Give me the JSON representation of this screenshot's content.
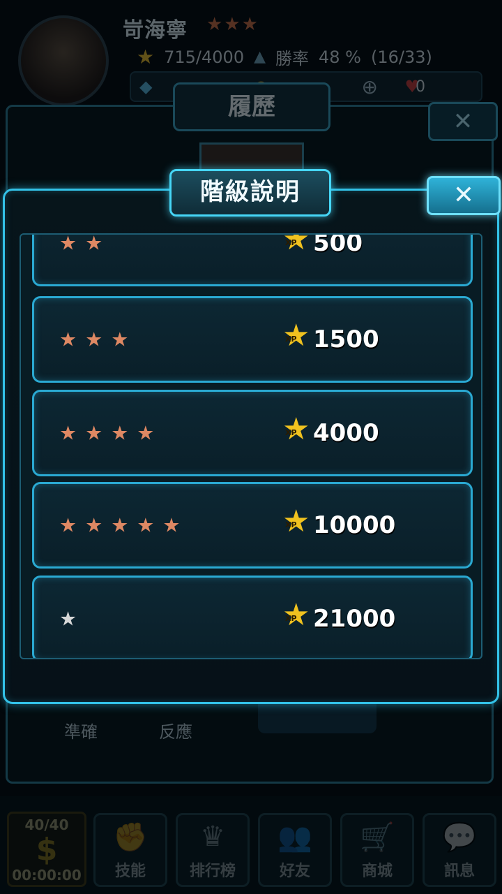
{
  "background": {
    "player_name": "岢海寧",
    "player_stars": "★★★",
    "xp_progress": "715/4000",
    "winrate_label": "勝率",
    "winrate_value": "48 %",
    "winrate_record": "(16/33)",
    "hearts": "0",
    "history_title": "履歷",
    "label_accuracy": "準確",
    "label_reaction": "反應"
  },
  "bottom_nav": {
    "energy": "40/40",
    "timer": "00:00:00",
    "items": [
      {
        "label": "技能",
        "icon": "fist-icon"
      },
      {
        "label": "排行榜",
        "icon": "trophy-icon"
      },
      {
        "label": "好友",
        "icon": "friends-icon"
      },
      {
        "label": "商城",
        "icon": "cart-icon"
      },
      {
        "label": "訊息",
        "icon": "chat-icon"
      }
    ]
  },
  "modal": {
    "title": "階級說明",
    "close_icon": "close-icon",
    "xp_badge_text": "XP",
    "ranks": [
      {
        "stars": "★★",
        "star_color": "bronze",
        "xp": "500"
      },
      {
        "stars": "★★★",
        "star_color": "bronze",
        "xp": "1500"
      },
      {
        "stars": "★★★★",
        "star_color": "bronze",
        "xp": "4000"
      },
      {
        "stars": "★★★★★",
        "star_color": "bronze",
        "xp": "10000"
      },
      {
        "stars": "★",
        "star_color": "silver",
        "xp": "21000"
      }
    ]
  },
  "colors": {
    "accent": "#33c2e8",
    "bronze_star": "#de8863",
    "silver_star": "#d7d7d7",
    "xp_gold": "#f0c21f"
  }
}
